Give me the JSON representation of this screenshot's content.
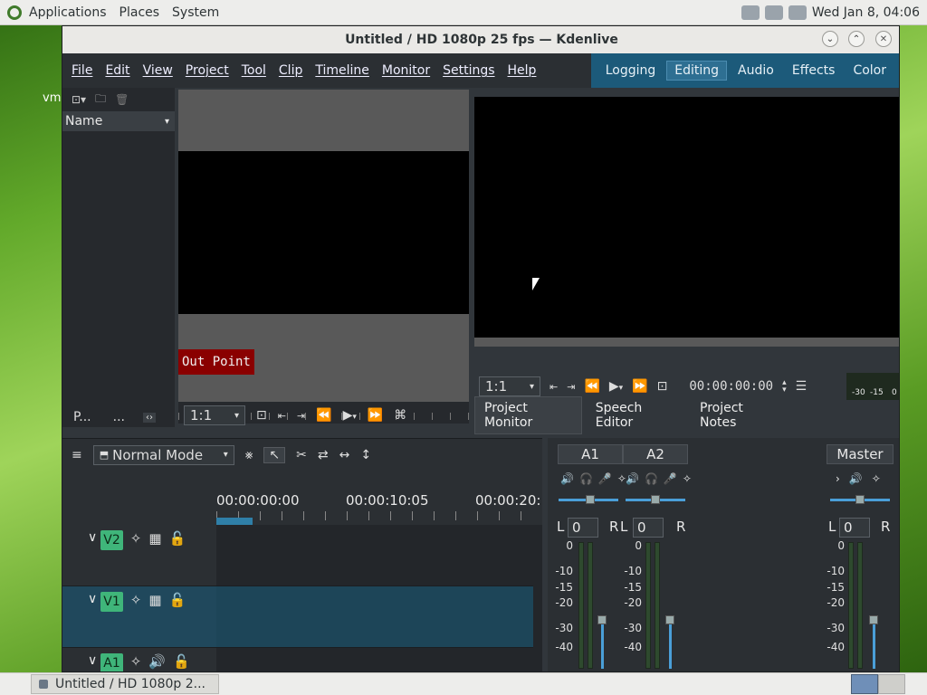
{
  "top_panel": {
    "menus": [
      "Applications",
      "Places",
      "System"
    ],
    "clock": "Wed Jan 8, 04:06"
  },
  "desktop": {
    "side_text": "vm"
  },
  "window": {
    "title": "Untitled / HD 1080p 25 fps — Kdenlive",
    "menu": [
      "File",
      "Edit",
      "View",
      "Project",
      "Tool",
      "Clip",
      "Timeline",
      "Monitor",
      "Settings",
      "Help"
    ],
    "layouts": [
      "Logging",
      "Editing",
      "Audio",
      "Effects",
      "Color"
    ],
    "active_layout": "Editing"
  },
  "bin": {
    "column_header": "Name",
    "bottom_buttons": [
      "P...",
      "..."
    ]
  },
  "clip_monitor": {
    "out_point_label": "Out Point",
    "zoom": "1:1"
  },
  "project_monitor": {
    "zoom": "1:1",
    "timecode": "00:00:00:00",
    "audio_scale": [
      "-30",
      "-15",
      "0"
    ],
    "tabs": [
      "Project Monitor",
      "Speech Editor",
      "Project Notes"
    ],
    "active_tab": "Project Monitor"
  },
  "timeline": {
    "mode": "Normal Mode",
    "ruler": [
      "00:00:00:00",
      "00:00:10:05",
      "00:00:20:"
    ],
    "tracks": [
      "V2",
      "V1",
      "A1"
    ]
  },
  "mixer": {
    "channels": [
      "A1",
      "A2",
      "Master"
    ],
    "balance_value": "0",
    "left_label": "L",
    "right_label": "R",
    "db_scale": [
      "0",
      "-10",
      "-15",
      "-20",
      "-30",
      "-40"
    ]
  },
  "taskbar": {
    "item": "Untitled / HD 1080p 2..."
  }
}
